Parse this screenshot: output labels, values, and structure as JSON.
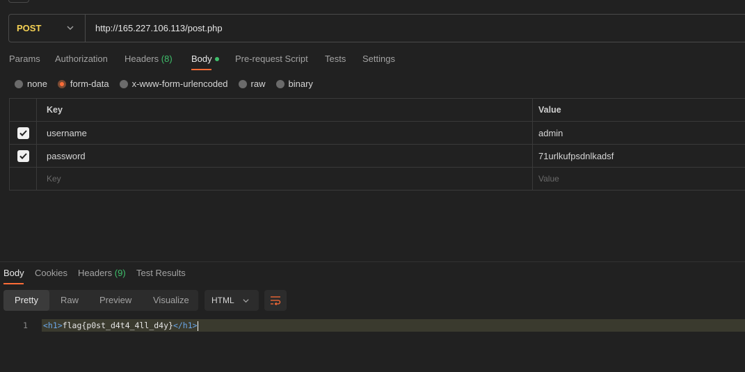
{
  "request": {
    "method": "POST",
    "url": "http://165.227.106.113/post.php"
  },
  "request_tabs": [
    {
      "label": "Params"
    },
    {
      "label": "Authorization"
    },
    {
      "label": "Headers",
      "count": "(8)"
    },
    {
      "label": "Body"
    },
    {
      "label": "Pre-request Script"
    },
    {
      "label": "Tests"
    },
    {
      "label": "Settings"
    }
  ],
  "body_modes": [
    "none",
    "form-data",
    "x-www-form-urlencoded",
    "raw",
    "binary"
  ],
  "selected_body_mode": "form-data",
  "form_table": {
    "headers": {
      "key": "Key",
      "value": "Value"
    },
    "rows": [
      {
        "checked": true,
        "key": "username",
        "value": "admin"
      },
      {
        "checked": true,
        "key": "password",
        "value": "71urlkufpsdnlkadsf"
      }
    ],
    "placeholder": {
      "key": "Key",
      "value": "Value"
    }
  },
  "response_tabs": [
    {
      "label": "Body"
    },
    {
      "label": "Cookies"
    },
    {
      "label": "Headers",
      "count": "(9)"
    },
    {
      "label": "Test Results"
    }
  ],
  "view_modes": [
    "Pretty",
    "Raw",
    "Preview",
    "Visualize"
  ],
  "format": "HTML",
  "response_body": {
    "line_number": "1",
    "open_tag": "<h1>",
    "text": "flag{p0st_d4t4_4ll_d4y}",
    "close_tag": "</h1>"
  },
  "colors": {
    "background": "#212121",
    "method": "#f5d154",
    "accent": "#ff6c37",
    "count": "#3fbf6b",
    "tag": "#6aa6e8"
  }
}
